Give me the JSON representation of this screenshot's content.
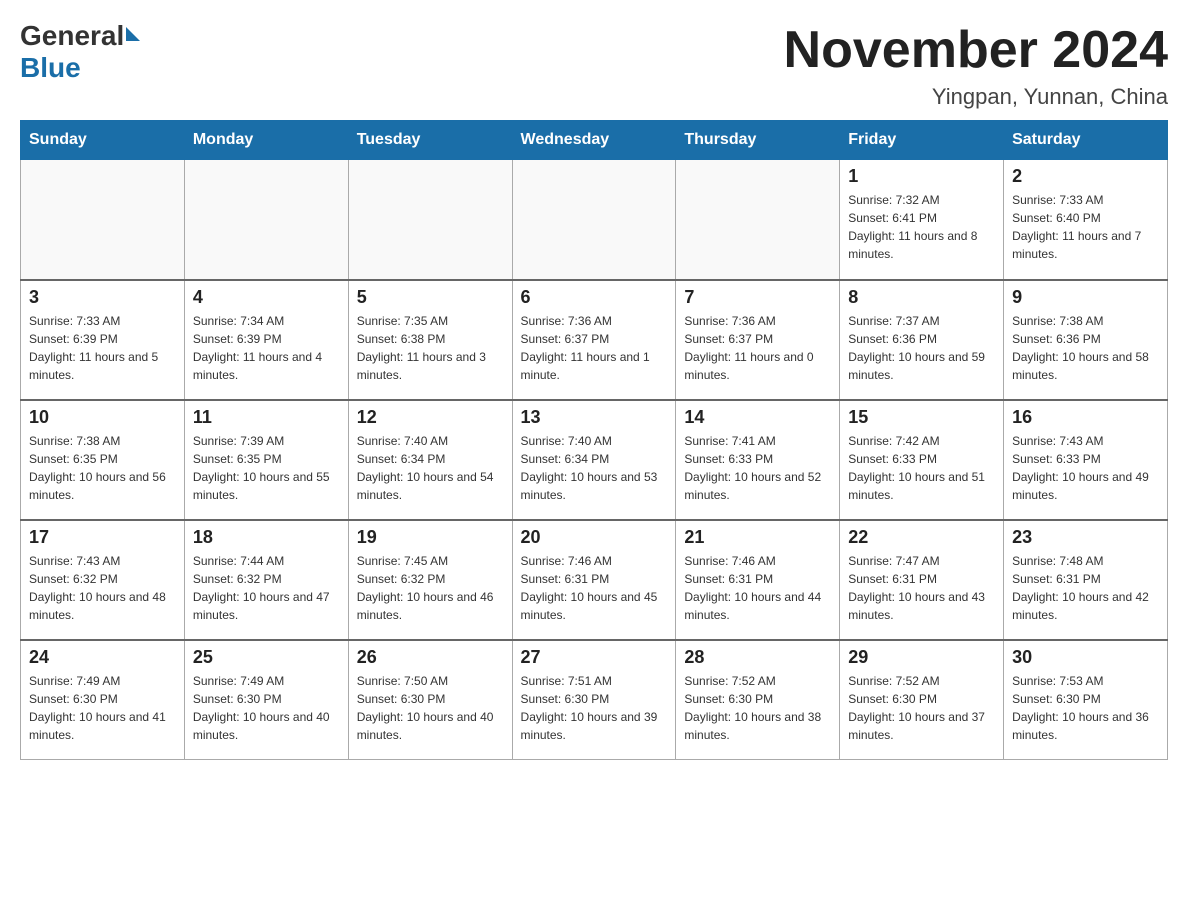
{
  "logo": {
    "general": "General",
    "blue": "Blue"
  },
  "title": "November 2024",
  "subtitle": "Yingpan, Yunnan, China",
  "days_of_week": [
    "Sunday",
    "Monday",
    "Tuesday",
    "Wednesday",
    "Thursday",
    "Friday",
    "Saturday"
  ],
  "weeks": [
    [
      {
        "day": "",
        "sunrise": "",
        "sunset": "",
        "daylight": ""
      },
      {
        "day": "",
        "sunrise": "",
        "sunset": "",
        "daylight": ""
      },
      {
        "day": "",
        "sunrise": "",
        "sunset": "",
        "daylight": ""
      },
      {
        "day": "",
        "sunrise": "",
        "sunset": "",
        "daylight": ""
      },
      {
        "day": "",
        "sunrise": "",
        "sunset": "",
        "daylight": ""
      },
      {
        "day": "1",
        "sunrise": "Sunrise: 7:32 AM",
        "sunset": "Sunset: 6:41 PM",
        "daylight": "Daylight: 11 hours and 8 minutes."
      },
      {
        "day": "2",
        "sunrise": "Sunrise: 7:33 AM",
        "sunset": "Sunset: 6:40 PM",
        "daylight": "Daylight: 11 hours and 7 minutes."
      }
    ],
    [
      {
        "day": "3",
        "sunrise": "Sunrise: 7:33 AM",
        "sunset": "Sunset: 6:39 PM",
        "daylight": "Daylight: 11 hours and 5 minutes."
      },
      {
        "day": "4",
        "sunrise": "Sunrise: 7:34 AM",
        "sunset": "Sunset: 6:39 PM",
        "daylight": "Daylight: 11 hours and 4 minutes."
      },
      {
        "day": "5",
        "sunrise": "Sunrise: 7:35 AM",
        "sunset": "Sunset: 6:38 PM",
        "daylight": "Daylight: 11 hours and 3 minutes."
      },
      {
        "day": "6",
        "sunrise": "Sunrise: 7:36 AM",
        "sunset": "Sunset: 6:37 PM",
        "daylight": "Daylight: 11 hours and 1 minute."
      },
      {
        "day": "7",
        "sunrise": "Sunrise: 7:36 AM",
        "sunset": "Sunset: 6:37 PM",
        "daylight": "Daylight: 11 hours and 0 minutes."
      },
      {
        "day": "8",
        "sunrise": "Sunrise: 7:37 AM",
        "sunset": "Sunset: 6:36 PM",
        "daylight": "Daylight: 10 hours and 59 minutes."
      },
      {
        "day": "9",
        "sunrise": "Sunrise: 7:38 AM",
        "sunset": "Sunset: 6:36 PM",
        "daylight": "Daylight: 10 hours and 58 minutes."
      }
    ],
    [
      {
        "day": "10",
        "sunrise": "Sunrise: 7:38 AM",
        "sunset": "Sunset: 6:35 PM",
        "daylight": "Daylight: 10 hours and 56 minutes."
      },
      {
        "day": "11",
        "sunrise": "Sunrise: 7:39 AM",
        "sunset": "Sunset: 6:35 PM",
        "daylight": "Daylight: 10 hours and 55 minutes."
      },
      {
        "day": "12",
        "sunrise": "Sunrise: 7:40 AM",
        "sunset": "Sunset: 6:34 PM",
        "daylight": "Daylight: 10 hours and 54 minutes."
      },
      {
        "day": "13",
        "sunrise": "Sunrise: 7:40 AM",
        "sunset": "Sunset: 6:34 PM",
        "daylight": "Daylight: 10 hours and 53 minutes."
      },
      {
        "day": "14",
        "sunrise": "Sunrise: 7:41 AM",
        "sunset": "Sunset: 6:33 PM",
        "daylight": "Daylight: 10 hours and 52 minutes."
      },
      {
        "day": "15",
        "sunrise": "Sunrise: 7:42 AM",
        "sunset": "Sunset: 6:33 PM",
        "daylight": "Daylight: 10 hours and 51 minutes."
      },
      {
        "day": "16",
        "sunrise": "Sunrise: 7:43 AM",
        "sunset": "Sunset: 6:33 PM",
        "daylight": "Daylight: 10 hours and 49 minutes."
      }
    ],
    [
      {
        "day": "17",
        "sunrise": "Sunrise: 7:43 AM",
        "sunset": "Sunset: 6:32 PM",
        "daylight": "Daylight: 10 hours and 48 minutes."
      },
      {
        "day": "18",
        "sunrise": "Sunrise: 7:44 AM",
        "sunset": "Sunset: 6:32 PM",
        "daylight": "Daylight: 10 hours and 47 minutes."
      },
      {
        "day": "19",
        "sunrise": "Sunrise: 7:45 AM",
        "sunset": "Sunset: 6:32 PM",
        "daylight": "Daylight: 10 hours and 46 minutes."
      },
      {
        "day": "20",
        "sunrise": "Sunrise: 7:46 AM",
        "sunset": "Sunset: 6:31 PM",
        "daylight": "Daylight: 10 hours and 45 minutes."
      },
      {
        "day": "21",
        "sunrise": "Sunrise: 7:46 AM",
        "sunset": "Sunset: 6:31 PM",
        "daylight": "Daylight: 10 hours and 44 minutes."
      },
      {
        "day": "22",
        "sunrise": "Sunrise: 7:47 AM",
        "sunset": "Sunset: 6:31 PM",
        "daylight": "Daylight: 10 hours and 43 minutes."
      },
      {
        "day": "23",
        "sunrise": "Sunrise: 7:48 AM",
        "sunset": "Sunset: 6:31 PM",
        "daylight": "Daylight: 10 hours and 42 minutes."
      }
    ],
    [
      {
        "day": "24",
        "sunrise": "Sunrise: 7:49 AM",
        "sunset": "Sunset: 6:30 PM",
        "daylight": "Daylight: 10 hours and 41 minutes."
      },
      {
        "day": "25",
        "sunrise": "Sunrise: 7:49 AM",
        "sunset": "Sunset: 6:30 PM",
        "daylight": "Daylight: 10 hours and 40 minutes."
      },
      {
        "day": "26",
        "sunrise": "Sunrise: 7:50 AM",
        "sunset": "Sunset: 6:30 PM",
        "daylight": "Daylight: 10 hours and 40 minutes."
      },
      {
        "day": "27",
        "sunrise": "Sunrise: 7:51 AM",
        "sunset": "Sunset: 6:30 PM",
        "daylight": "Daylight: 10 hours and 39 minutes."
      },
      {
        "day": "28",
        "sunrise": "Sunrise: 7:52 AM",
        "sunset": "Sunset: 6:30 PM",
        "daylight": "Daylight: 10 hours and 38 minutes."
      },
      {
        "day": "29",
        "sunrise": "Sunrise: 7:52 AM",
        "sunset": "Sunset: 6:30 PM",
        "daylight": "Daylight: 10 hours and 37 minutes."
      },
      {
        "day": "30",
        "sunrise": "Sunrise: 7:53 AM",
        "sunset": "Sunset: 6:30 PM",
        "daylight": "Daylight: 10 hours and 36 minutes."
      }
    ]
  ]
}
